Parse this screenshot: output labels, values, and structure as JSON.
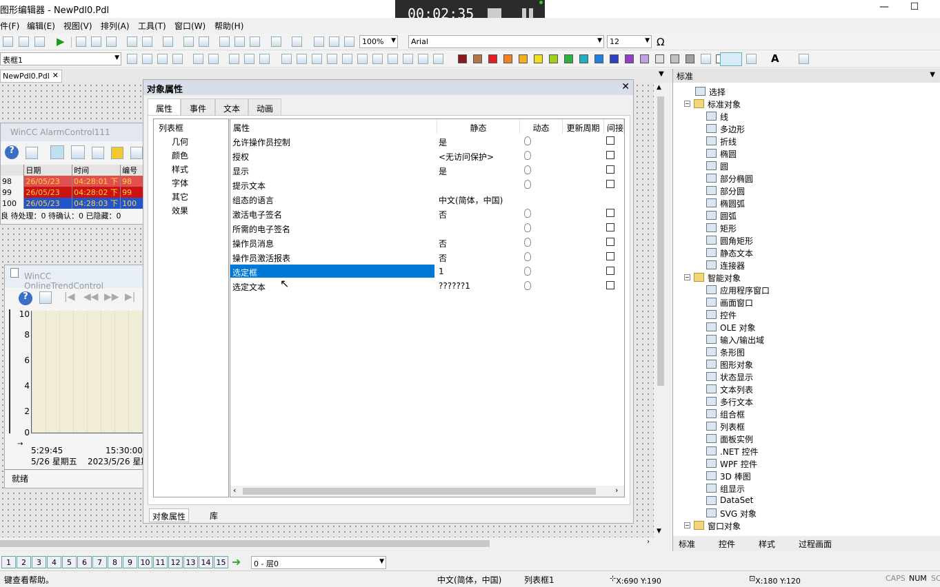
{
  "window": {
    "title": "图形编辑器 - NewPdl0.Pdl"
  },
  "recorder": {
    "time": "00:02:35"
  },
  "menu": [
    "件(F)",
    "编辑(E)",
    "视图(V)",
    "排列(A)",
    "工具(T)",
    "窗口(W)",
    "帮助(H)"
  ],
  "toolbar": {
    "zoom": "100%",
    "font": "Arial",
    "font_size": "12",
    "object_combo": "表框1",
    "omega": "Ω"
  },
  "doc_tab": {
    "label": "NewPdl0.Pdl"
  },
  "alarm": {
    "caption": "WinCC AlarmControl111",
    "headers": [
      "日期",
      "时间",
      "编号"
    ],
    "rows": [
      {
        "idx": "98",
        "date": "26/05/23",
        "time": "04:28:01 下",
        "num": "98",
        "color": "#e05050"
      },
      {
        "idx": "99",
        "date": "26/05/23",
        "time": "04:28:02 下",
        "num": "99",
        "color": "#cc1111"
      },
      {
        "idx": "100",
        "date": "26/05/23",
        "time": "04:28:03 下",
        "num": "100",
        "color": "#2255cc"
      }
    ],
    "status": "良 待处理：0  待确认：0  已隐藏：0"
  },
  "trend": {
    "caption": "WinCC OnlineTrendControl",
    "y_ticks": [
      "10",
      "8",
      "6",
      "4",
      "2",
      "0"
    ],
    "x_time1": "5:29:45",
    "x_time2": "15:30:00",
    "x_date1": "5/26 星期五",
    "x_date2": "2023/5/26 星期",
    "status": "就绪"
  },
  "dialog": {
    "title": "对象属性",
    "tabs": [
      "属性",
      "事件",
      "文本",
      "动画"
    ],
    "tree": [
      "列表框",
      "几何",
      "颜色",
      "样式",
      "字体",
      "其它",
      "效果"
    ],
    "columns": [
      "属性",
      "静态",
      "动态",
      "更新周期",
      "间接"
    ],
    "rows": [
      {
        "name": "允许操作员控制",
        "static": "是",
        "bulb": true,
        "chk": true
      },
      {
        "name": "授权",
        "static": "<无访问保护>",
        "bulb": true,
        "chk": true
      },
      {
        "name": "显示",
        "static": "是",
        "bulb": true,
        "chk": true
      },
      {
        "name": "提示文本",
        "static": "",
        "bulb": true,
        "chk": true
      },
      {
        "name": "组态的语言",
        "static": "中文(简体，中国)",
        "bulb": false,
        "chk": false
      },
      {
        "name": "激活电子签名",
        "static": "否",
        "bulb": true,
        "chk": true
      },
      {
        "name": "所需的电子签名",
        "static": "",
        "bulb": true,
        "chk": true
      },
      {
        "name": "操作员消息",
        "static": "否",
        "bulb": true,
        "chk": true
      },
      {
        "name": "操作员激活报表",
        "static": "否",
        "bulb": true,
        "chk": true
      },
      {
        "name": "选定框",
        "static": "1",
        "bulb": true,
        "chk": true,
        "selected": true
      },
      {
        "name": "选定文本",
        "static": "??????1",
        "bulb": true,
        "chk": true
      }
    ],
    "bottom_tabs": [
      "对象属性",
      "库"
    ]
  },
  "palette": {
    "header": "标准",
    "items": [
      {
        "label": "选择",
        "level": 1
      },
      {
        "label": "标准对象",
        "level": 0
      },
      {
        "label": "线",
        "level": 2
      },
      {
        "label": "多边形",
        "level": 2
      },
      {
        "label": "折线",
        "level": 2
      },
      {
        "label": "椭圆",
        "level": 2
      },
      {
        "label": "圆",
        "level": 2
      },
      {
        "label": "部分椭圆",
        "level": 2
      },
      {
        "label": "部分圆",
        "level": 2
      },
      {
        "label": "椭圆弧",
        "level": 2
      },
      {
        "label": "圆弧",
        "level": 2
      },
      {
        "label": "矩形",
        "level": 2
      },
      {
        "label": "圆角矩形",
        "level": 2
      },
      {
        "label": "静态文本",
        "level": 2
      },
      {
        "label": "连接器",
        "level": 2
      },
      {
        "label": "智能对象",
        "level": 0
      },
      {
        "label": "应用程序窗口",
        "level": 2
      },
      {
        "label": "画面窗口",
        "level": 2
      },
      {
        "label": "控件",
        "level": 2
      },
      {
        "label": "OLE 对象",
        "level": 2
      },
      {
        "label": "输入/输出域",
        "level": 2
      },
      {
        "label": "条形图",
        "level": 2
      },
      {
        "label": "图形对象",
        "level": 2
      },
      {
        "label": "状态显示",
        "level": 2
      },
      {
        "label": "文本列表",
        "level": 2
      },
      {
        "label": "多行文本",
        "level": 2
      },
      {
        "label": "组合框",
        "level": 2
      },
      {
        "label": "列表框",
        "level": 2
      },
      {
        "label": "面板实例",
        "level": 2
      },
      {
        "label": ".NET 控件",
        "level": 2
      },
      {
        "label": "WPF 控件",
        "level": 2
      },
      {
        "label": "3D 棒图",
        "level": 2
      },
      {
        "label": "组显示",
        "level": 2
      },
      {
        "label": "DataSet",
        "level": 2
      },
      {
        "label": "SVG 对象",
        "level": 2
      },
      {
        "label": "窗口对象",
        "level": 0
      }
    ],
    "tabs": [
      "标准",
      "控件",
      "样式",
      "过程画面"
    ]
  },
  "layers": {
    "numbers": [
      "1",
      "2",
      "3",
      "4",
      "5",
      "6",
      "7",
      "8",
      "9",
      "10",
      "11",
      "12",
      "13",
      "14",
      "15"
    ],
    "current": "0 - 层0"
  },
  "status": {
    "help": "键查看帮助。",
    "language": "中文(简体，中国)",
    "object": "列表框1",
    "pos": "X:690 Y:190",
    "size": "X:180 Y:120",
    "caps": "CAPS",
    "num": "NUM",
    "scrl": "SC"
  },
  "colors": {
    "accent": "#0078d7",
    "swatches": [
      "#8b1a1a",
      "#b0784a",
      "#e02020",
      "#f08020",
      "#f0b020",
      "#f0e020",
      "#a0d020",
      "#30b040",
      "#20b0c0",
      "#2080e0",
      "#3040c0",
      "#9040c0",
      "#c0a0e0",
      "#e0e0e0",
      "#c0c0c0",
      "#a0a0a0",
      "#000000",
      "#ffffff"
    ]
  }
}
